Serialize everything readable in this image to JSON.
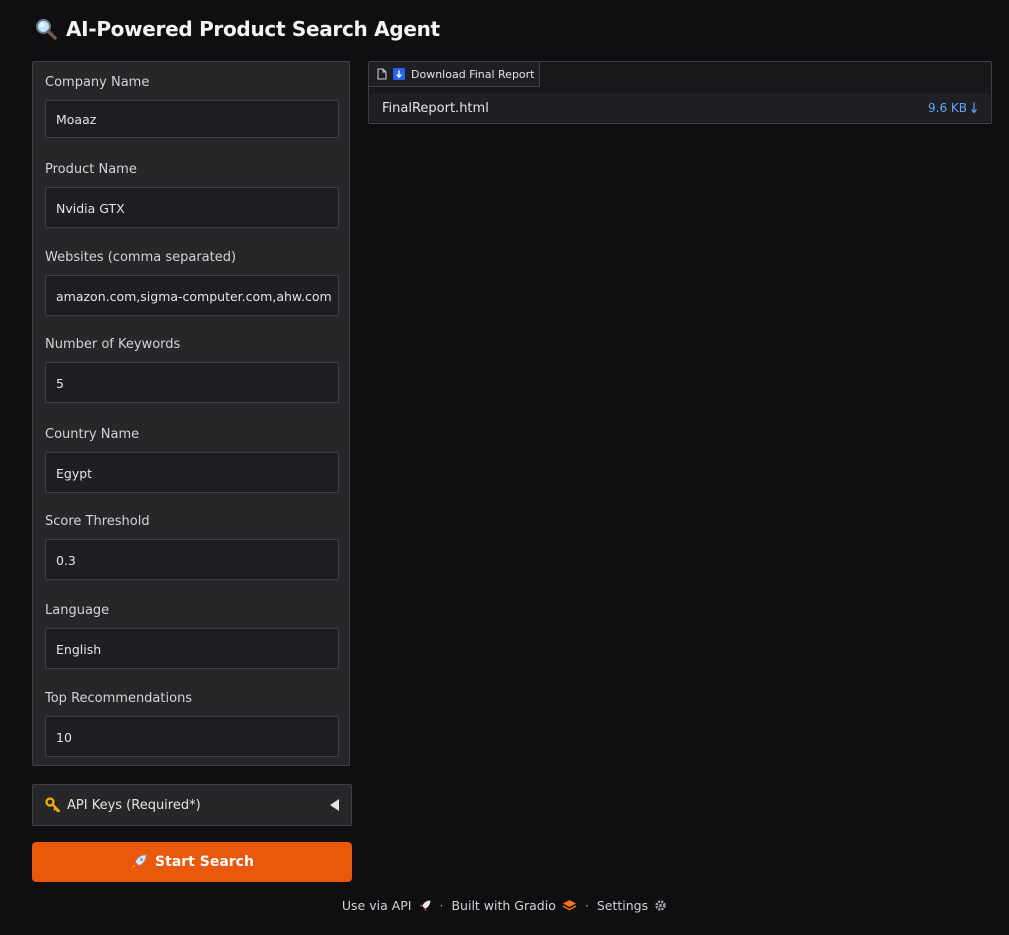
{
  "app": {
    "title": "AI-Powered Product Search Agent"
  },
  "form": {
    "fields": [
      {
        "label": "Company Name",
        "value": "Moaaz"
      },
      {
        "label": "Product Name",
        "value": "Nvidia GTX"
      },
      {
        "label": "Websites (comma separated)",
        "value": "amazon.com,sigma-computer.com,ahw.com"
      },
      {
        "label": "Number of Keywords",
        "value": "5"
      },
      {
        "label": "Country Name",
        "value": "Egypt"
      },
      {
        "label": "Score Threshold",
        "value": "0.3"
      },
      {
        "label": "Language",
        "value": "English"
      },
      {
        "label": "Top Recommendations",
        "value": "10"
      }
    ]
  },
  "api_keys": {
    "label": "API Keys (Required*)",
    "icon": "key-icon",
    "state": "collapsed"
  },
  "start_button": {
    "label": "Start Search",
    "icon": "rocket-icon",
    "color": "#ea580c"
  },
  "output": {
    "tab_label": "Download Final Report",
    "file_name": "FinalReport.html",
    "file_size": "9.6 KB",
    "link_color": "#60a5fa"
  },
  "footer": {
    "api_label": "Use via API",
    "built_label": "Built with Gradio",
    "settings_label": "Settings",
    "separator": "·"
  },
  "colors": {
    "background": "#0f0f11",
    "panel": "#27272a",
    "border": "#3f3f46",
    "accent": "#ea580c"
  }
}
